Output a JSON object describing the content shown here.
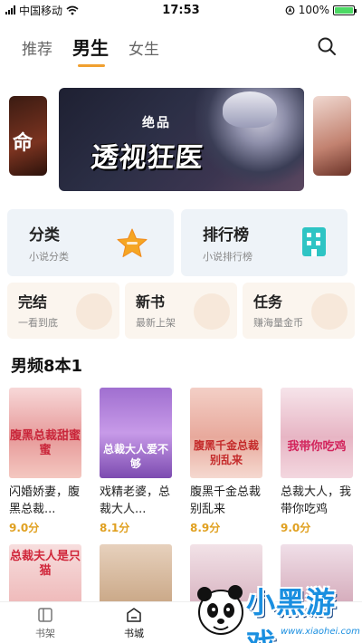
{
  "status": {
    "carrier": "中国移动",
    "time": "17:53",
    "battery_text": "100%",
    "battery_level": 1.0
  },
  "tabs": [
    {
      "label": "推荐",
      "active": false
    },
    {
      "label": "男生",
      "active": true
    },
    {
      "label": "女生",
      "active": false
    }
  ],
  "banner": {
    "small_text": "绝品",
    "title": "透视狂医",
    "side_left_glyph": "命"
  },
  "categories": [
    {
      "title": "分类",
      "sub": "小说分类",
      "icon": "star-icon"
    },
    {
      "title": "排行榜",
      "sub": "小说排行榜",
      "icon": "building-icon"
    }
  ],
  "features": [
    {
      "title": "完结",
      "sub": "一看到底"
    },
    {
      "title": "新书",
      "sub": "最新上架"
    },
    {
      "title": "任务",
      "sub": "赚海量金币"
    }
  ],
  "section": {
    "title": "男频8本1"
  },
  "books": [
    {
      "title": "闪婚娇妻，腹黑总裁...",
      "score": "9.0分",
      "cover_text": "腹黑总裁甜蜜蜜"
    },
    {
      "title": "戏精老婆，总裁大人...",
      "score": "8.1分",
      "cover_text": "总裁大人爱不够"
    },
    {
      "title": "腹黑千金总裁别乱来",
      "score": "8.9分",
      "cover_text": "腹黑千金总裁别乱来"
    },
    {
      "title": "总裁大人，我带你吃鸡",
      "score": "9.0分",
      "cover_text": "我带你吃鸡"
    }
  ],
  "row2_cover_texts": [
    "总裁夫人是只猫",
    "",
    "",
    ""
  ],
  "bottom_nav": [
    {
      "label": "书架",
      "icon": "bookshelf-icon",
      "active": false
    },
    {
      "label": "书城",
      "icon": "bookstore-icon",
      "active": true
    }
  ],
  "watermark": {
    "text": "小黑游戏",
    "url": "www.xiaohei.com"
  },
  "colors": {
    "accent": "#f0a030",
    "score": "#e0a020",
    "card_bg": "#eef3f8",
    "feature_bg": "#fbf5ee",
    "watermark_blue": "#1a8fe0"
  }
}
